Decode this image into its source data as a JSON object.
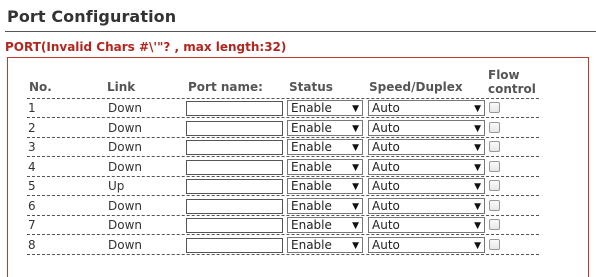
{
  "page": {
    "title": "Port Configuration",
    "section_label": "PORT(Invalid Chars #\\'\"? , max length:32)"
  },
  "table": {
    "headers": {
      "no": "No.",
      "link": "Link",
      "port_name": "Port name:",
      "status": "Status",
      "speed_duplex": "Speed/Duplex",
      "flow_control": "Flow control"
    },
    "rows": [
      {
        "no": "1",
        "link": "Down",
        "port_name": "",
        "status": "Enable",
        "speed": "Auto",
        "flow_control": false
      },
      {
        "no": "2",
        "link": "Down",
        "port_name": "",
        "status": "Enable",
        "speed": "Auto",
        "flow_control": false
      },
      {
        "no": "3",
        "link": "Down",
        "port_name": "",
        "status": "Enable",
        "speed": "Auto",
        "flow_control": false
      },
      {
        "no": "4",
        "link": "Down",
        "port_name": "",
        "status": "Enable",
        "speed": "Auto",
        "flow_control": false
      },
      {
        "no": "5",
        "link": "Up",
        "port_name": "",
        "status": "Enable",
        "speed": "Auto",
        "flow_control": false
      },
      {
        "no": "6",
        "link": "Down",
        "port_name": "",
        "status": "Enable",
        "speed": "Auto",
        "flow_control": false
      },
      {
        "no": "7",
        "link": "Down",
        "port_name": "",
        "status": "Enable",
        "speed": "Auto",
        "flow_control": false
      },
      {
        "no": "8",
        "link": "Down",
        "port_name": "",
        "status": "Enable",
        "speed": "Auto",
        "flow_control": false
      }
    ]
  },
  "icons": {
    "select_arrow": "▼"
  },
  "colors": {
    "section_label": "#b3261e",
    "panel_border": "#c0392b"
  }
}
